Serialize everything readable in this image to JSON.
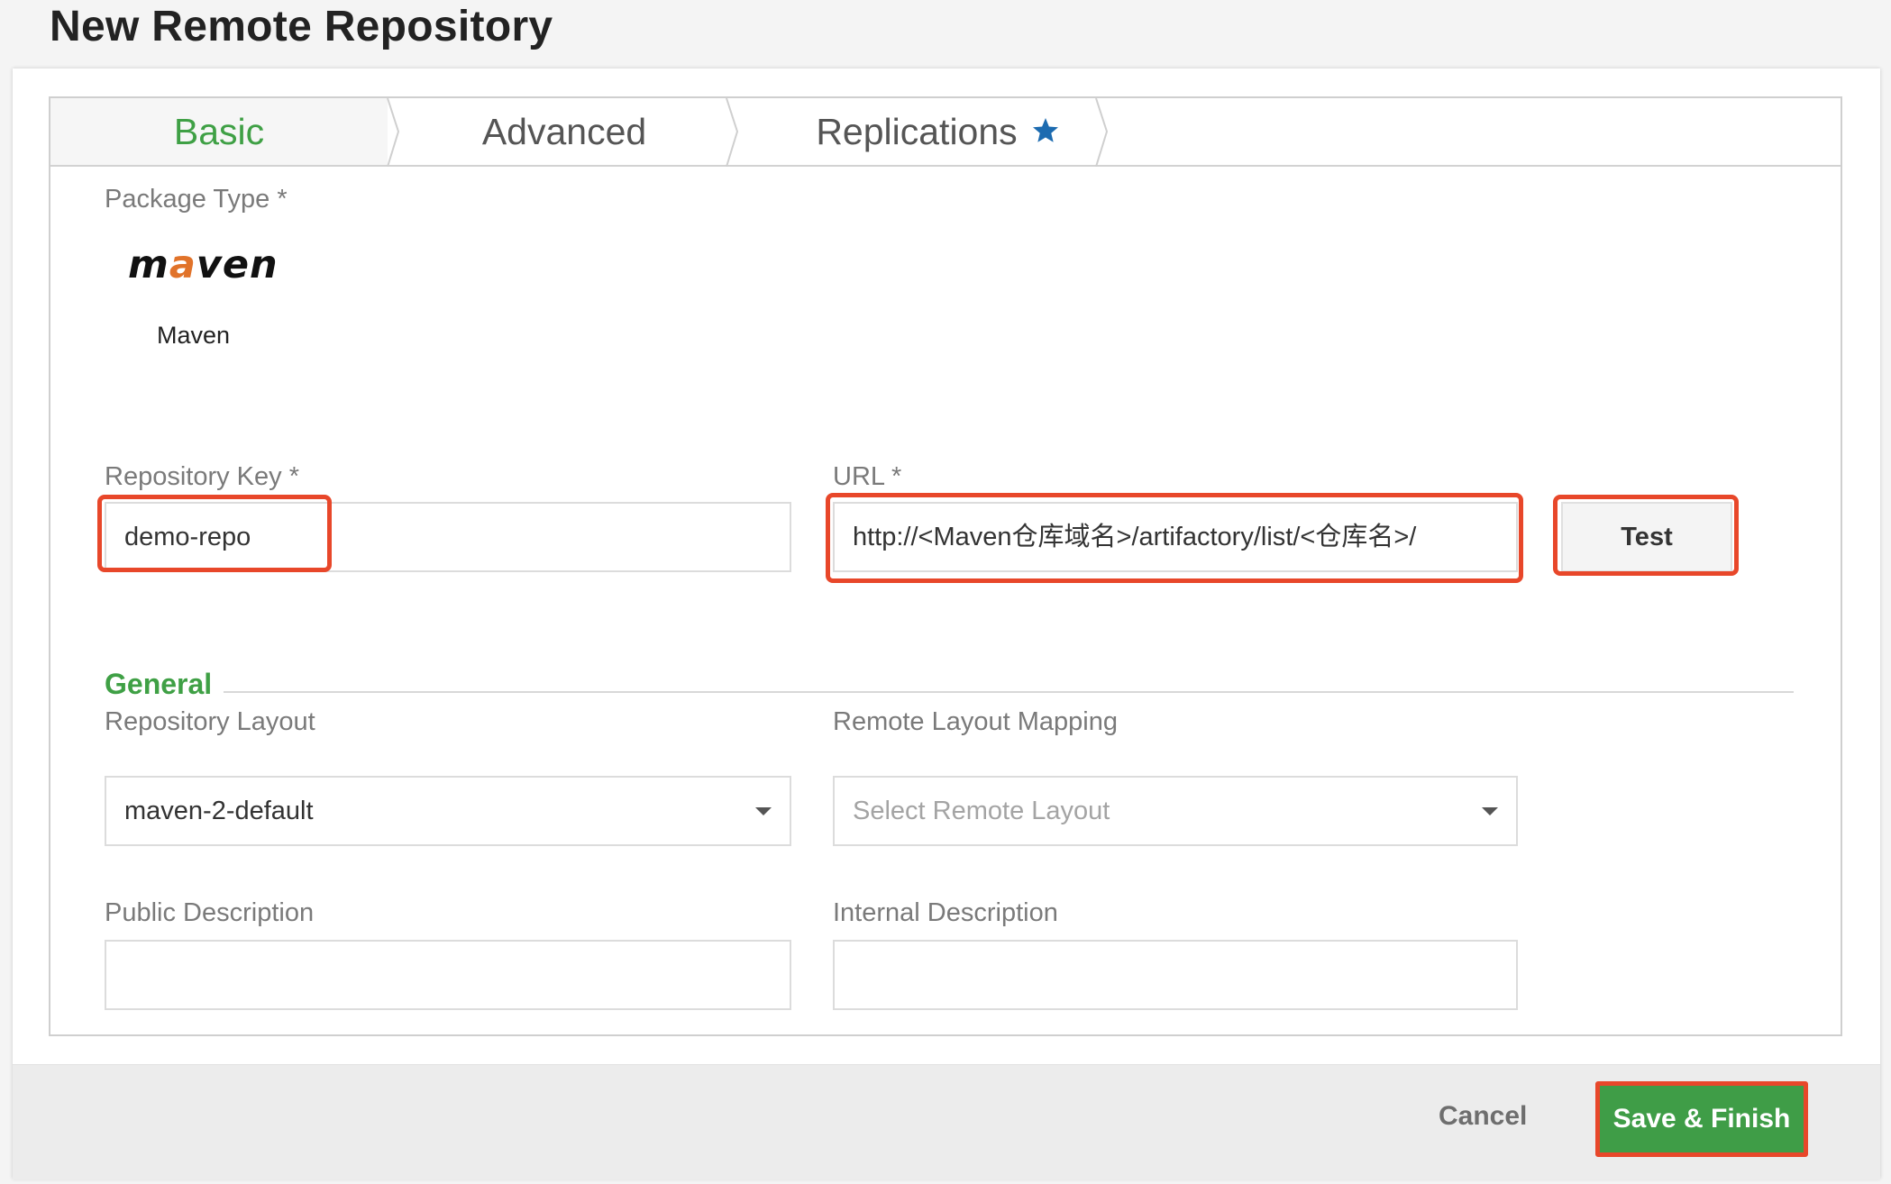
{
  "page": {
    "title": "New Remote Repository"
  },
  "tabs": [
    {
      "label": "Basic",
      "active": true
    },
    {
      "label": "Advanced",
      "active": false
    },
    {
      "label": "Replications",
      "active": false,
      "icon": "star-icon"
    }
  ],
  "package_type": {
    "label": "Package Type *",
    "logo_text_1": "m",
    "logo_text_a": "a",
    "logo_text_2": "ven",
    "name": "Maven"
  },
  "repository_key": {
    "label": "Repository Key *",
    "value": "demo-repo"
  },
  "url": {
    "label": "URL *",
    "value": "http://<Maven仓库域名>/artifactory/list/<仓库名>/"
  },
  "test_button": {
    "label": "Test"
  },
  "general": {
    "title": "General",
    "repository_layout": {
      "label": "Repository Layout",
      "value": "maven-2-default"
    },
    "remote_layout_mapping": {
      "label": "Remote Layout Mapping",
      "placeholder": "Select Remote Layout"
    },
    "public_description": {
      "label": "Public Description",
      "value": ""
    },
    "internal_description": {
      "label": "Internal Description",
      "value": ""
    }
  },
  "footer": {
    "cancel_label": "Cancel",
    "save_label": "Save & Finish"
  },
  "colors": {
    "accent_green": "#3fa045",
    "highlight_red": "#e8472a",
    "star_blue": "#1c6bb0",
    "maven_orange": "#e1732a"
  }
}
